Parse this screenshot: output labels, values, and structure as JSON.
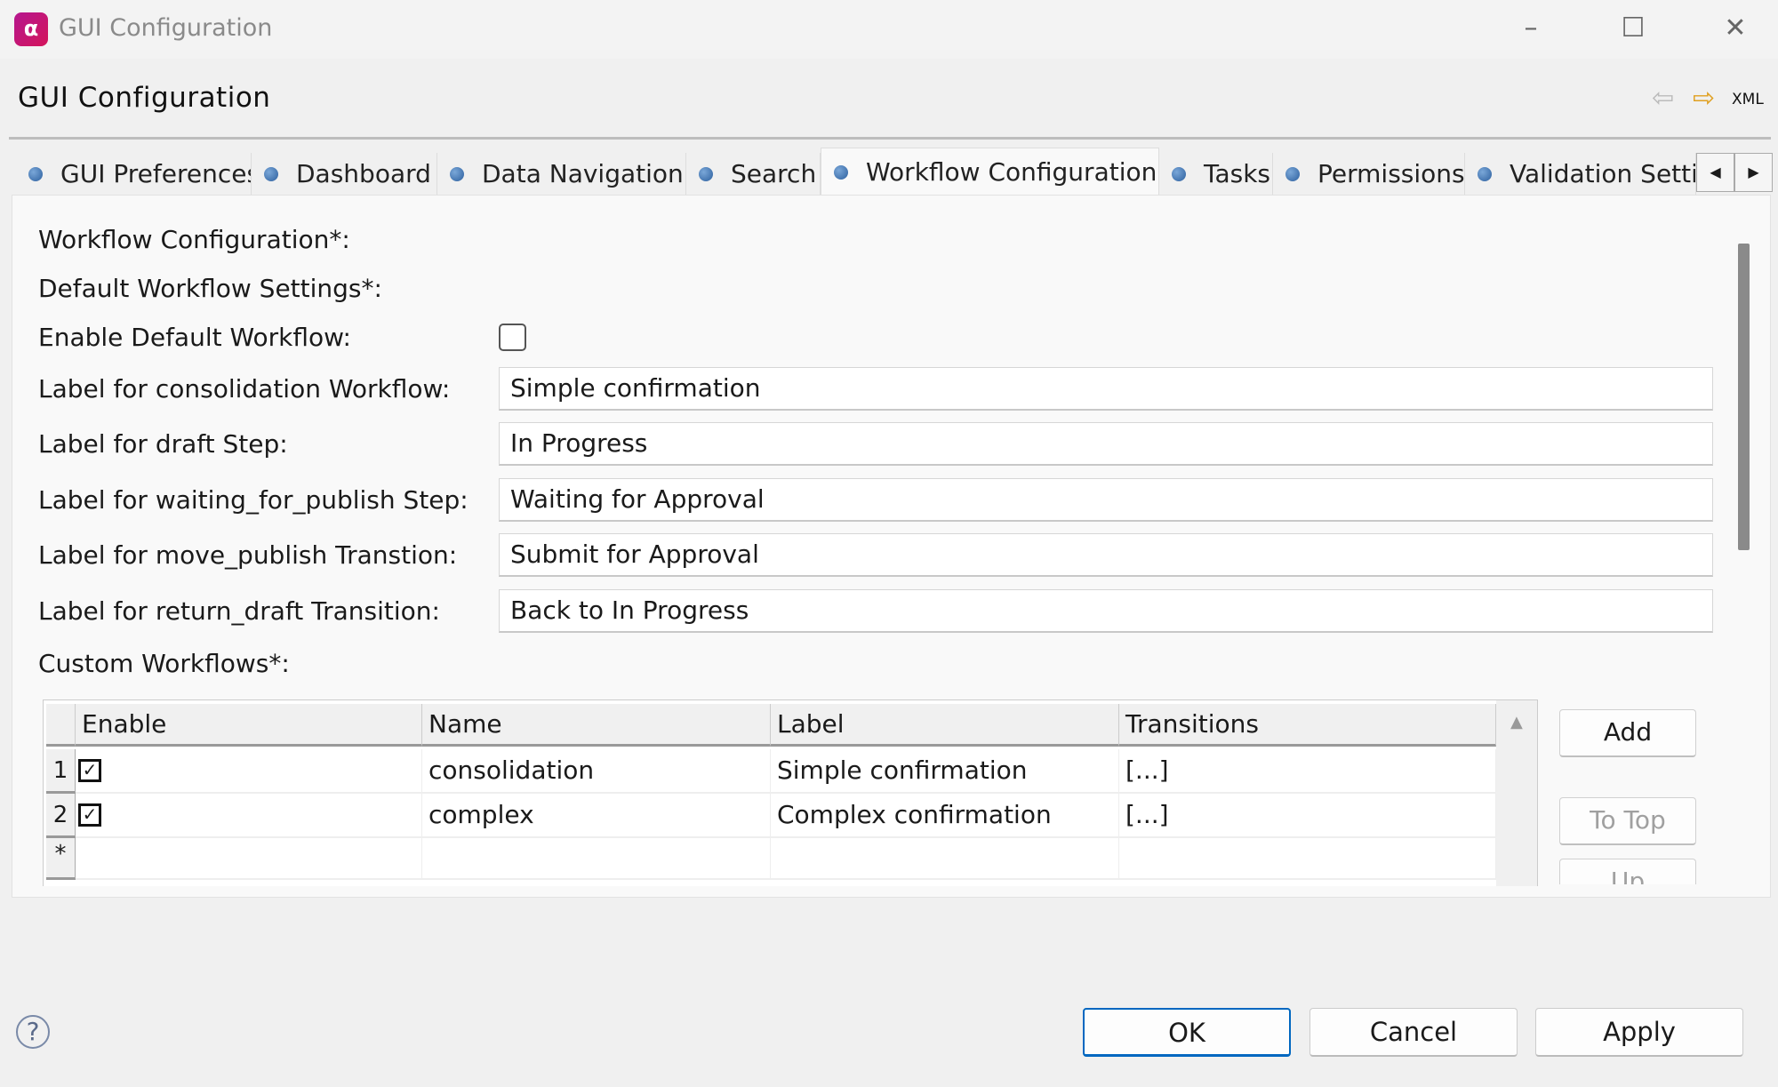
{
  "window": {
    "title": "GUI Configuration",
    "controls": {
      "minimize": "–",
      "maximize": "☐",
      "close": "✕"
    }
  },
  "header": {
    "title": "GUI Configuration",
    "back_icon": "arrow-left-icon",
    "forward_icon": "arrow-right-icon",
    "xml_label": "XML"
  },
  "tabs": [
    {
      "label": "GUI Preferences"
    },
    {
      "label": "Dashboard"
    },
    {
      "label": "Data Navigation"
    },
    {
      "label": "Search"
    },
    {
      "label": "Workflow Configuration",
      "selected": true
    },
    {
      "label": "Tasks"
    },
    {
      "label": "Permissions"
    },
    {
      "label": "Validation Settings"
    }
  ],
  "form": {
    "workflow_configuration": "Workflow Configuration*:",
    "default_settings": "Default Workflow Settings*:",
    "enable_default": {
      "label": "Enable Default Workflow:",
      "checked": false
    },
    "fields": [
      {
        "label": "Label for consolidation Workflow:",
        "value": "Simple confirmation"
      },
      {
        "label": "Label for draft Step:",
        "value": "In Progress"
      },
      {
        "label": "Label for waiting_for_publish Step:",
        "value": "Waiting for Approval"
      },
      {
        "label": "Label for move_publish Transtion:",
        "value": "Submit for Approval"
      },
      {
        "label": "Label for return_draft Transition:",
        "value": "Back to In Progress"
      }
    ],
    "custom_workflows": "Custom Workflows*:"
  },
  "table": {
    "columns": [
      "Enable",
      "Name",
      "Label",
      "Transitions"
    ],
    "rows": [
      {
        "num": "1",
        "enabled": true,
        "name": "consolidation",
        "label": "Simple confirmation",
        "transitions": "[...]"
      },
      {
        "num": "2",
        "enabled": true,
        "name": "complex",
        "label": "Complex confirmation",
        "transitions": "[...]"
      }
    ],
    "new_row_marker": "*"
  },
  "side_buttons": {
    "add": "Add",
    "to_top": "To Top",
    "up": "Up"
  },
  "footer": {
    "help": "?",
    "ok": "OK",
    "cancel": "Cancel",
    "apply": "Apply"
  },
  "colors": {
    "accent": "#0067c0",
    "app_icon": "#c4157a"
  }
}
